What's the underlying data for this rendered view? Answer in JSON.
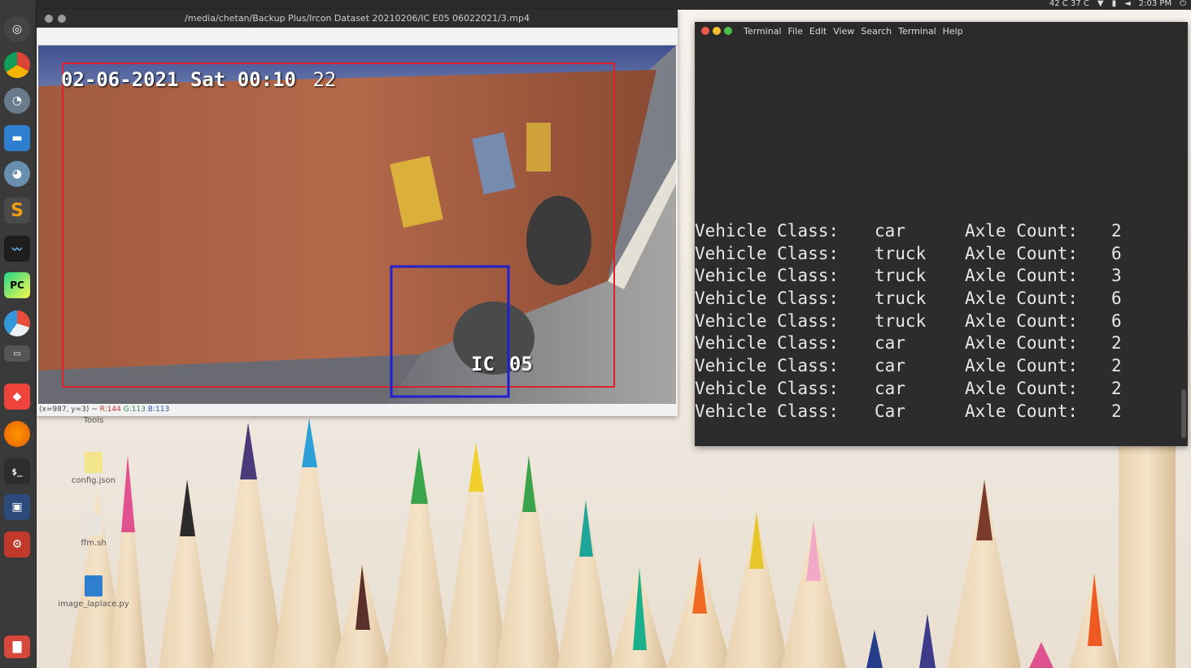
{
  "topbar": {
    "tray_text": "42 C 37 C",
    "clock": "2:03 PM"
  },
  "launcher": {
    "items": [
      {
        "icon": "ubuntu-dash-icon",
        "label": ""
      },
      {
        "icon": "chrome-icon",
        "label": ""
      },
      {
        "icon": "disk-usage-icon",
        "label": ""
      },
      {
        "icon": "files-icon",
        "label": ""
      },
      {
        "icon": "disk-icon",
        "label": ""
      },
      {
        "icon": "sublime-text-icon",
        "label": "S"
      },
      {
        "icon": "system-monitor-icon",
        "label": ""
      },
      {
        "icon": "pycharm-icon",
        "label": "PC"
      },
      {
        "icon": "pie-chart-icon",
        "label": ""
      },
      {
        "icon": "window-icon",
        "label": ""
      },
      {
        "icon": "anydesk-icon",
        "label": ""
      },
      {
        "icon": "firefox-icon",
        "label": ""
      },
      {
        "icon": "terminal-icon",
        "label": "$_"
      },
      {
        "icon": "camera-icon",
        "label": ""
      },
      {
        "icon": "settings-icon",
        "label": ""
      },
      {
        "icon": "trash-icon",
        "label": ""
      }
    ]
  },
  "video_window": {
    "title": "/media/chetan/Backup Plus/Ircon Dataset 20210206/IC E05 06022021/3.mp4",
    "overlay_timestamp": "02-06-2021 Sat 00:10",
    "overlay_seconds": "22",
    "overlay_cam_left": "IC",
    "overlay_cam_right": "05",
    "status_prefix": "(x=987, y=3) ~",
    "status_r": "R:144",
    "status_g": "G:113",
    "status_b": "B:113"
  },
  "terminal": {
    "menu": [
      "Terminal",
      "File",
      "Edit",
      "View",
      "Search",
      "Terminal",
      "Help"
    ],
    "rows": [
      {
        "label": "Vehicle Class:",
        "cls": "car",
        "axle_label": "Axle Count:",
        "count": "2"
      },
      {
        "label": "Vehicle Class:",
        "cls": "truck",
        "axle_label": "Axle Count:",
        "count": "6"
      },
      {
        "label": "Vehicle Class:",
        "cls": "truck",
        "axle_label": "Axle Count:",
        "count": "3"
      },
      {
        "label": "Vehicle Class:",
        "cls": "truck",
        "axle_label": "Axle Count:",
        "count": "6"
      },
      {
        "label": "Vehicle Class:",
        "cls": "truck",
        "axle_label": "Axle Count:",
        "count": "6"
      },
      {
        "label": "Vehicle Class:",
        "cls": "car",
        "axle_label": "Axle Count:",
        "count": "2"
      },
      {
        "label": "Vehicle Class:",
        "cls": "car",
        "axle_label": "Axle Count:",
        "count": "2"
      },
      {
        "label": "Vehicle Class:",
        "cls": "car",
        "axle_label": "Axle Count:",
        "count": "2"
      },
      {
        "label": "Vehicle Class:",
        "cls": "Car",
        "axle_label": "Axle Count:",
        "count": "2"
      }
    ]
  },
  "desktop": {
    "icons": [
      {
        "label": "Tools"
      },
      {
        "label": "config.json"
      },
      {
        "label": "ffm.sh"
      },
      {
        "label": "image_laplace.py"
      }
    ]
  }
}
